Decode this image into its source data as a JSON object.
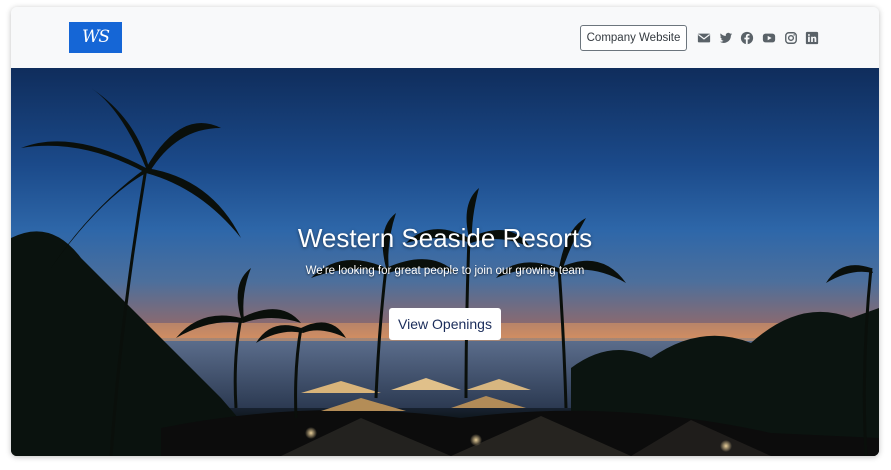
{
  "navbar": {
    "logo_text": "WS",
    "company_button_label": "Company Website",
    "social_icons": [
      "envelope-icon",
      "twitter-icon",
      "facebook-icon",
      "youtube-icon",
      "instagram-icon",
      "linkedin-icon"
    ]
  },
  "hero": {
    "title": "Western Seaside Resorts",
    "subtitle": "We're looking for great people to join our growing team",
    "cta_label": "View Openings"
  },
  "colors": {
    "brand_blue": "#1566d6",
    "navbar_bg": "#f8f9fa",
    "icon_gray": "#5a6268"
  }
}
